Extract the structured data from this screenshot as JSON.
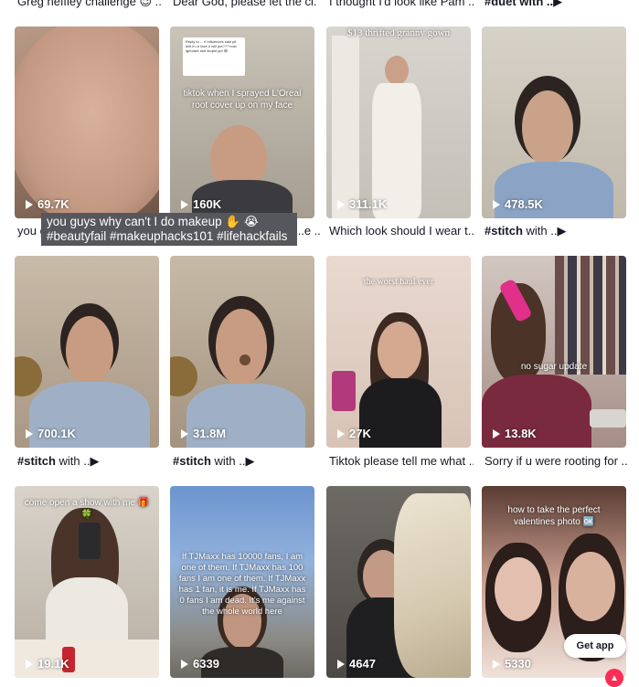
{
  "top_captions": [
    {
      "text": "Greg heffley challenge 😉 ..."
    },
    {
      "text": "Dear God, please let the cl..."
    },
    {
      "text": "I thought I'd look like Pam ..."
    },
    {
      "text": "#duet with ..▶"
    }
  ],
  "videos": [
    {
      "views": "69.7K",
      "caption": "you g...",
      "overlay": ""
    },
    {
      "views": "160K",
      "caption": "...e ...",
      "overlay": "tiktok when I sprayed L'Oreal root cover up on my face",
      "comment": "Reply to ... If influences said pit shit in ur face u will put??? how ignorant and stupid ppl 😂"
    },
    {
      "views": "311.1K",
      "caption": "Which look should I wear t...",
      "overlay": "$13 thrifted granny gown"
    },
    {
      "views": "478.5K",
      "caption_tag": "#stitch",
      "caption": " with ..▶",
      "overlay": ""
    },
    {
      "views": "700.1K",
      "caption_tag": "#stitch",
      "caption": " with ..▶",
      "overlay": ""
    },
    {
      "views": "31.8M",
      "caption_tag": "#stitch",
      "caption": " with ..▶",
      "overlay": ""
    },
    {
      "views": "27K",
      "caption": "Tiktok please tell me what ...",
      "overlay": "the worst haul ever"
    },
    {
      "views": "13.8K",
      "caption": "Sorry if u were rooting for ...",
      "overlay": "no sugar update"
    },
    {
      "views": "19.1K",
      "caption": "",
      "overlay": "come open a show with me 🎁🍀"
    },
    {
      "views": "6339",
      "caption": "",
      "overlay": "If TJMaxx has 10000 fans, I am one of them. If TJMaxx has 100 fans I am one of them. If TJMaxx has 1 fan, it is me. If TJMaxx has 0 fans I am dead. It's me against the whole world here"
    },
    {
      "views": "4647",
      "caption": "",
      "overlay": ""
    },
    {
      "views": "5330",
      "caption": "",
      "overlay": "how to take the perfect valentines photo 🆗"
    }
  ],
  "tooltip": {
    "line1": "you guys why can't I do makeup ✋ 😭",
    "line2": "#beautyfail #makeuphacks101 #lifehackfails"
  },
  "get_app": "Get app",
  "colors": {
    "accent": "#fe2c55",
    "tooltip_bg": "#56575d"
  }
}
